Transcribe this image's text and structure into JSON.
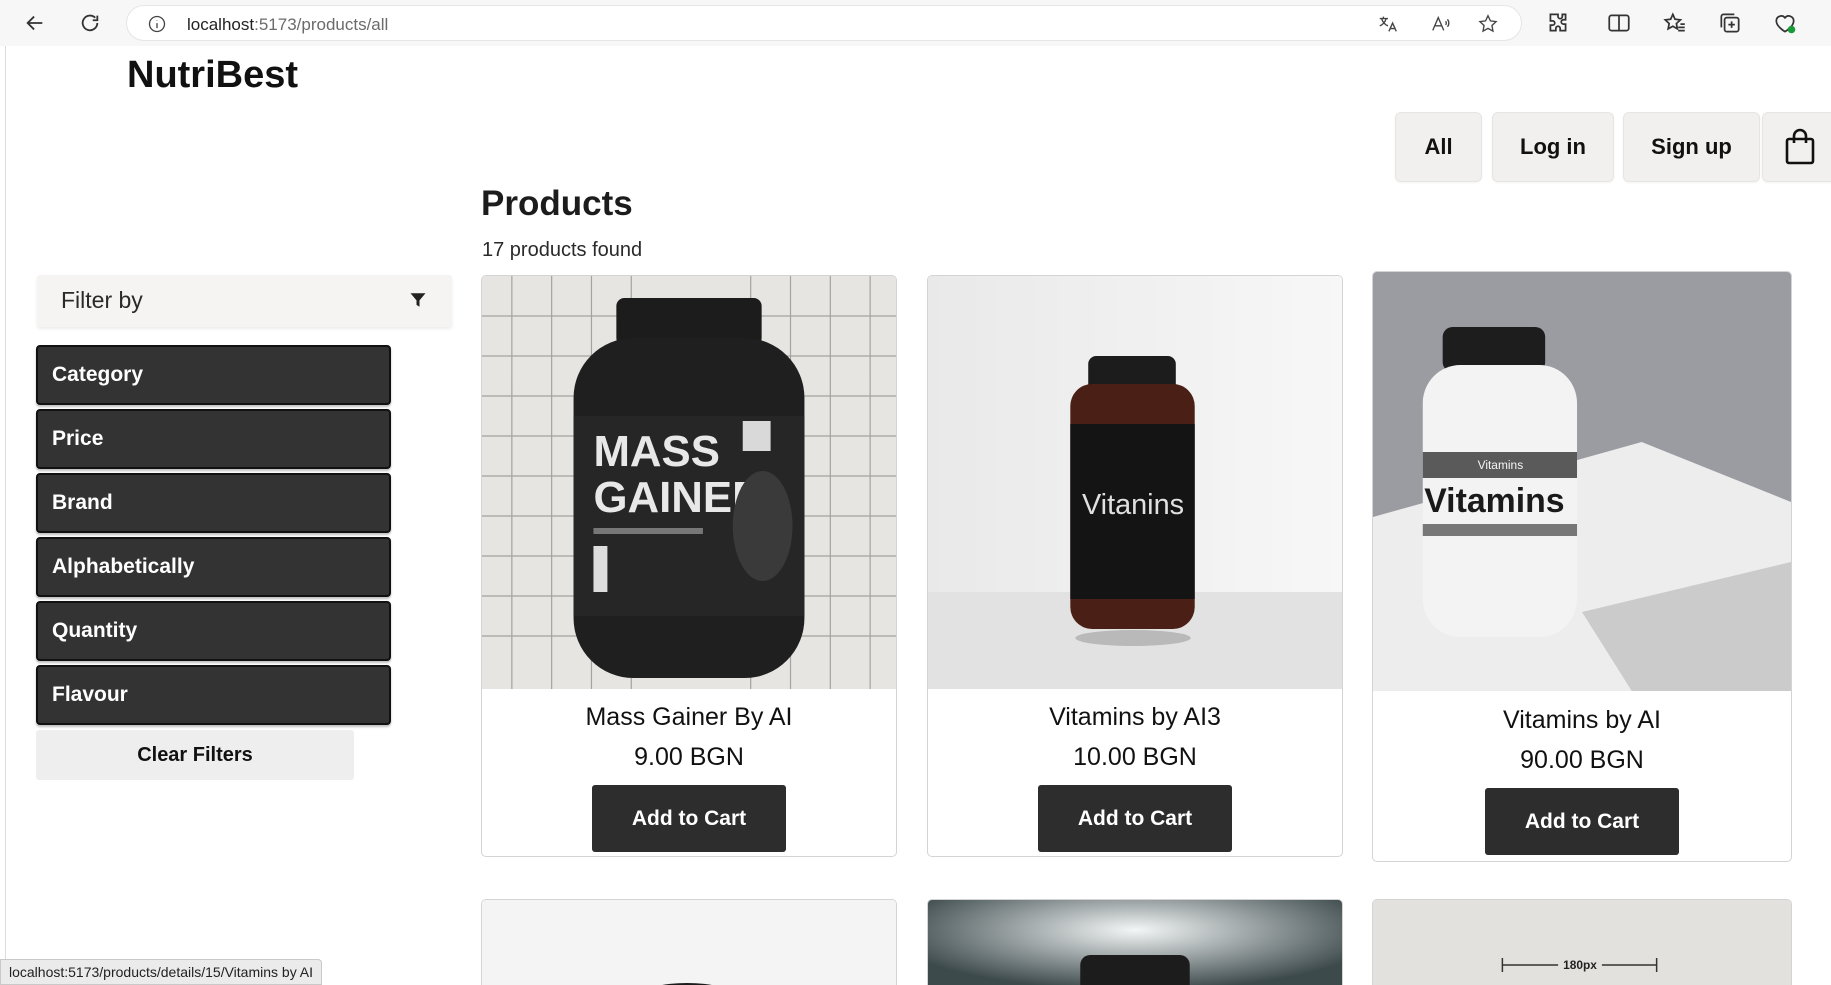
{
  "browser": {
    "url_host": "localhost",
    "url_path": ":5173/products/all",
    "status_url": "localhost:5173/products/details/15/Vitamins by AI"
  },
  "site": {
    "brand": "NutriBest"
  },
  "nav": {
    "all": "All",
    "login": "Log in",
    "signup": "Sign up",
    "cart_icon": "shopping-bag-icon"
  },
  "main": {
    "title": "Products",
    "found": "17 products found"
  },
  "filters": {
    "header": "Filter by",
    "items": [
      "Category",
      "Price",
      "Brand",
      "Alphabetically",
      "Quantity",
      "Flavour"
    ],
    "clear": "Clear Filters"
  },
  "products": [
    {
      "name": "Mass Gainer By AI",
      "price": "9.00 BGN",
      "cta": "Add to Cart",
      "label_line1": "MASS",
      "label_line2": "GAINER"
    },
    {
      "name": "Vitamins by AI3",
      "price": "10.00 BGN",
      "cta": "Add to Cart",
      "label": "Vitanins"
    },
    {
      "name": "Vitamins by AI",
      "price": "90.00 BGN",
      "cta": "Add to Cart",
      "label": "Vitamins",
      "label_small": "Vitamins"
    }
  ],
  "partial_cards": {
    "third_label": "180px"
  },
  "colors": {
    "dark_button": "#2d2d2d",
    "nav_bg": "#f1f0ee"
  }
}
